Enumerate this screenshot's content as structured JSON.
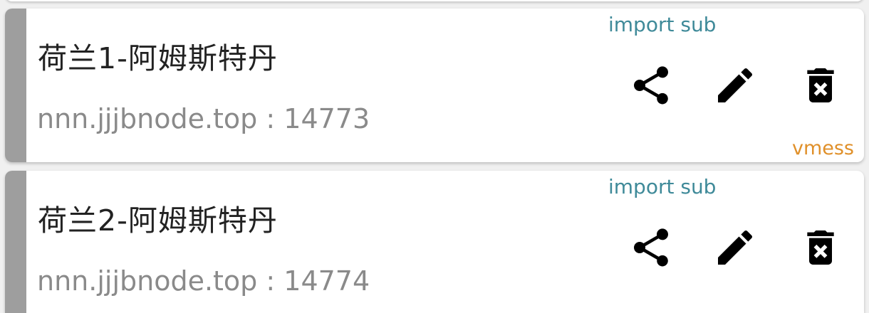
{
  "servers": [
    {
      "name": "荷兰1-阿姆斯特丹",
      "address": "nnn.jjjbnode.top : 14773",
      "subscription": "import sub",
      "protocol": "vmess"
    },
    {
      "name": "荷兰2-阿姆斯特丹",
      "address": "nnn.jjjbnode.top : 14774",
      "subscription": "import sub",
      "protocol": ""
    }
  ],
  "icons": {
    "share": "share-icon",
    "edit": "edit-icon",
    "delete": "delete-icon"
  },
  "colors": {
    "subscription": "#3f8a99",
    "protocol": "#e0902a",
    "stripe": "#9e9e9e"
  }
}
